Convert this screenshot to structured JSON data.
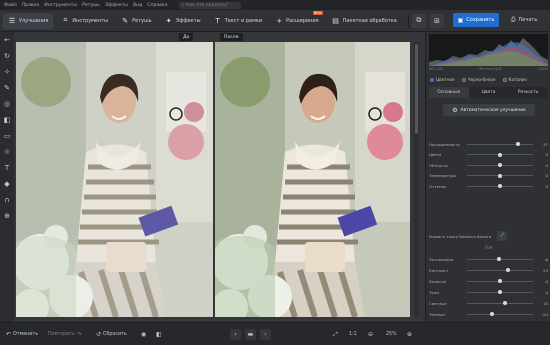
{
  "menu": [
    "Файл",
    "Правка",
    "Инструменты",
    "Ретушь",
    "Эффекты",
    "Вид",
    "Справка"
  ],
  "menu_search": "Как это сделать?",
  "toolbar": {
    "tabs": [
      {
        "label": "Улучшения",
        "icon": "sliders-icon"
      },
      {
        "label": "Инструменты",
        "icon": "crop-icon"
      },
      {
        "label": "Ретушь",
        "icon": "brush-icon"
      },
      {
        "label": "Эффекты",
        "icon": "magic-icon"
      },
      {
        "label": "Текст и рамки",
        "icon": "text-icon"
      },
      {
        "label": "Расширения",
        "icon": "plus-icon",
        "badge": "NEW"
      },
      {
        "label": "Пакетная обработка",
        "icon": "batch-icon"
      }
    ],
    "save_label": "Сохранить",
    "print_label": "Печать"
  },
  "canvas": {
    "before_label": "До",
    "after_label": "После"
  },
  "bottom": {
    "undo_label": "Отменить",
    "redo_label": "Повторить",
    "reset_label": "Сбросить",
    "ratio_label": "1:1",
    "zoom_label": "25%"
  },
  "histogram_info": {
    "iso": "ISO 100",
    "focal": "85 mm f/2.8",
    "shutter": "1/500"
  },
  "color_modes": [
    "Цветное",
    "Черно-белое",
    "Катализ"
  ],
  "selected_color_mode": 0,
  "panel_tabs": [
    "Основные",
    "Цвета",
    "Резкость"
  ],
  "auto_button": "Автоматическое улучшение",
  "color_sliders": [
    {
      "label": "Насыщенность",
      "value": "37",
      "fraction": 0.78
    },
    {
      "label": "Цвета",
      "value": "0",
      "fraction": 0.5
    },
    {
      "label": "Чёткость",
      "value": "0",
      "fraction": 0.5
    },
    {
      "label": "Температура",
      "value": "0",
      "fraction": 0.5
    },
    {
      "label": "Оттенок",
      "value": "0",
      "fraction": 0.5
    }
  ],
  "white_balance_label": "Указать точку баланса белого",
  "tone_section": "Тон",
  "tone_sliders": [
    {
      "label": "Экспозиция",
      "value": "-6",
      "fraction": 0.48
    },
    {
      "label": "Контраст",
      "value": "23",
      "fraction": 0.62
    },
    {
      "label": "Засветы",
      "value": "0",
      "fraction": 0.5
    },
    {
      "label": "Тени",
      "value": "0",
      "fraction": 0.5
    },
    {
      "label": "Светлые",
      "value": "15",
      "fraction": 0.58
    },
    {
      "label": "Тёмные",
      "value": "-24",
      "fraction": 0.38
    }
  ],
  "colors": {
    "accent": "#1f6fd0",
    "badge": "#e0542e"
  }
}
